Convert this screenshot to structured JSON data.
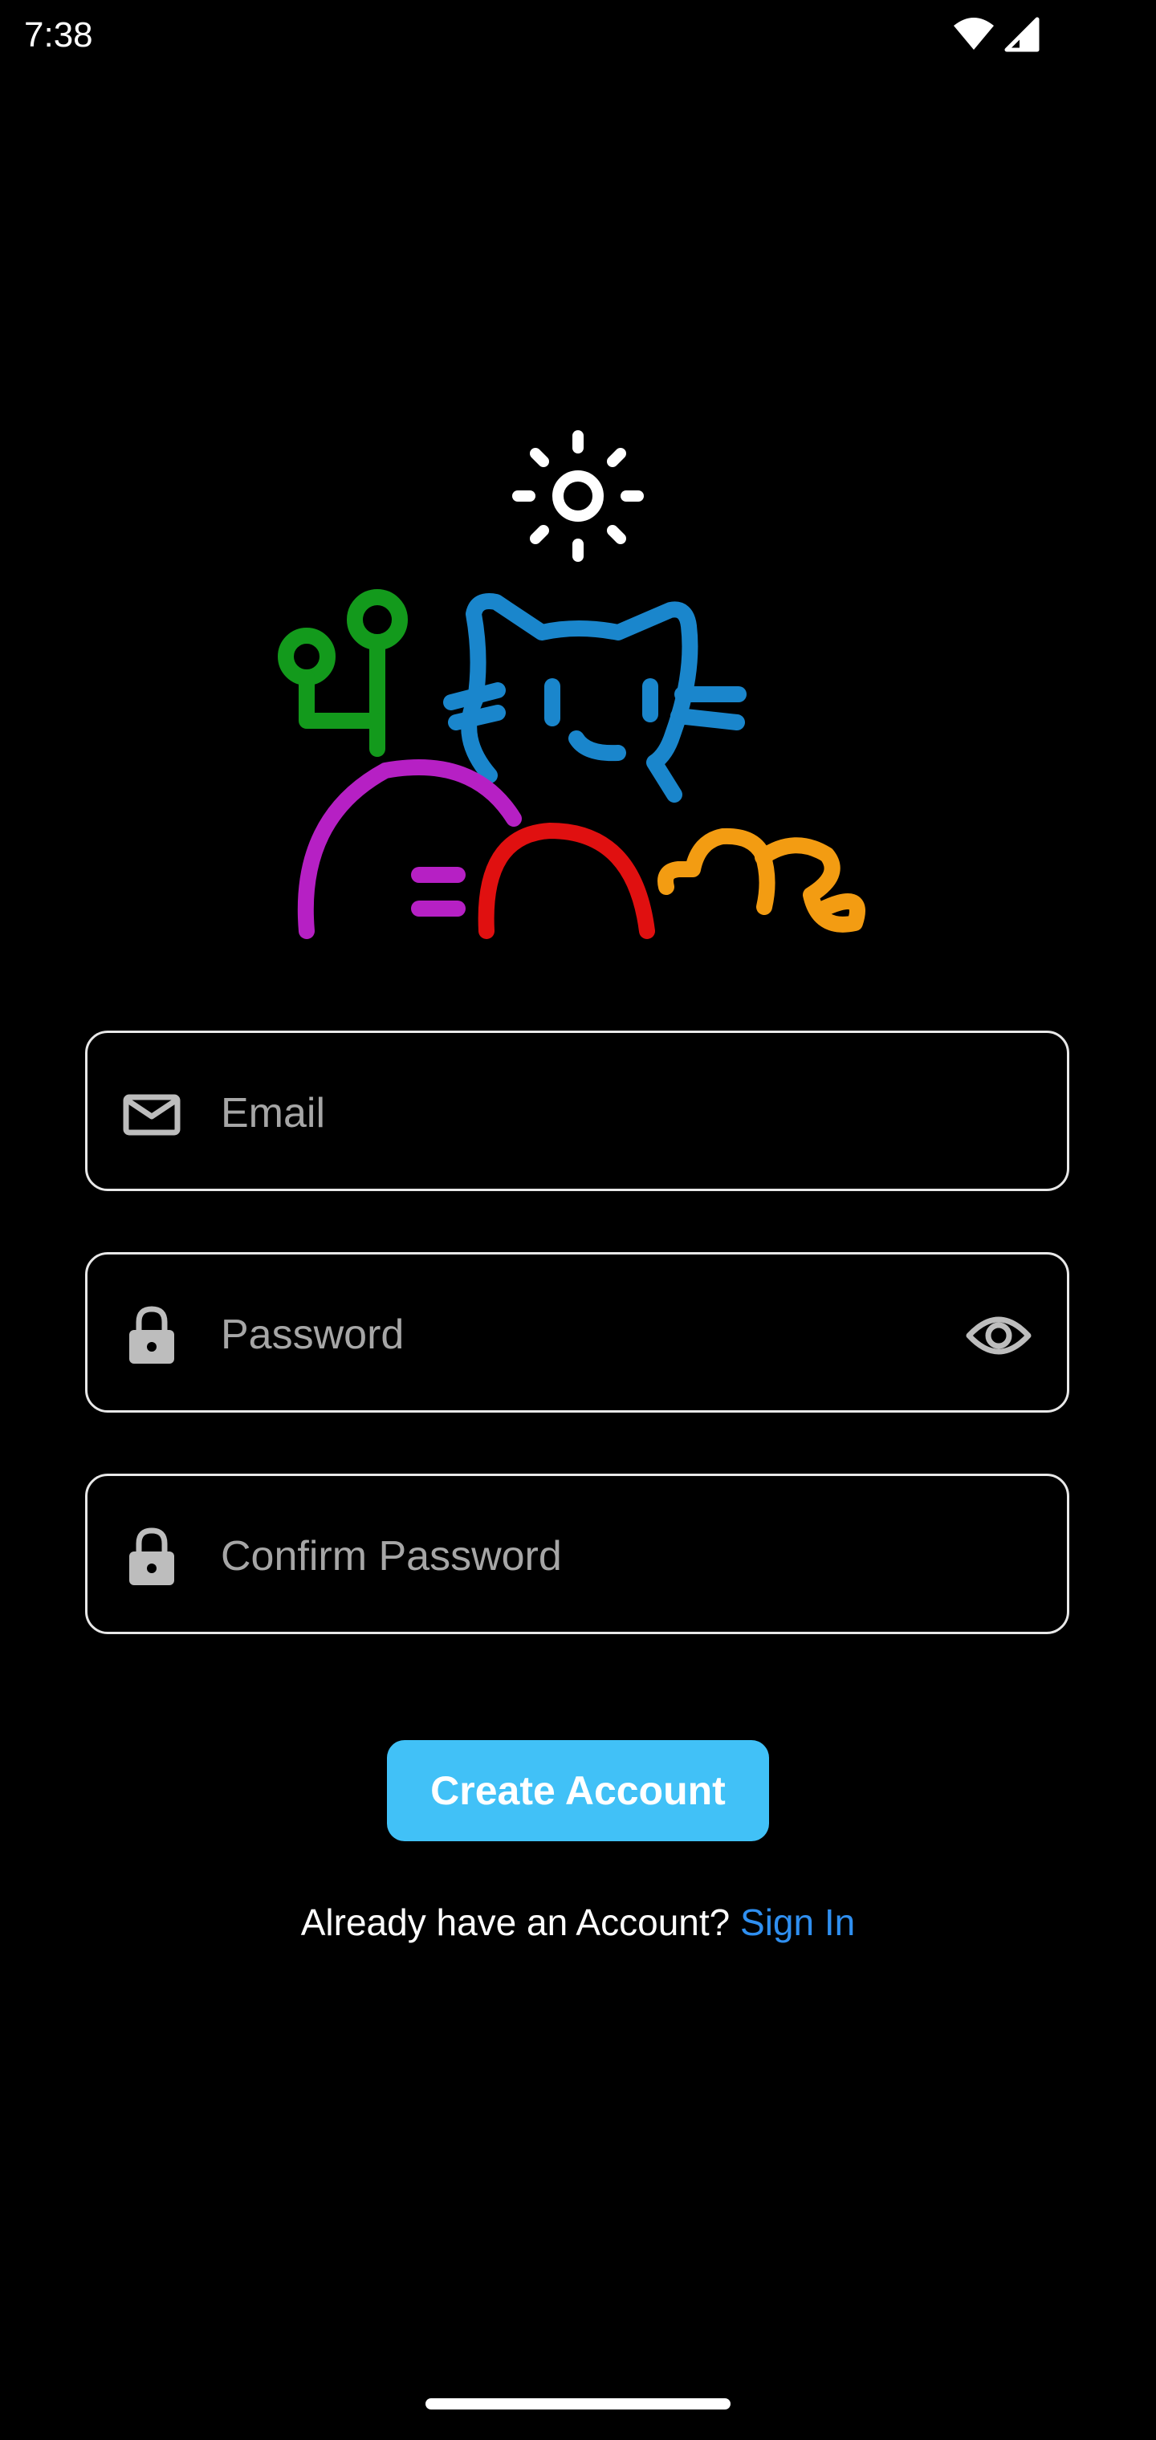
{
  "status_bar": {
    "time": "7:38",
    "icons": [
      "wifi-icon",
      "signal-icon"
    ]
  },
  "logo": {
    "icons": [
      "sun-icon",
      "plant-icon",
      "cat-icon",
      "arch-icon",
      "caterpillar-icon"
    ],
    "colors": {
      "sun": "#ffffff",
      "plant": "#139a1c",
      "cat": "#1a86cc",
      "magenta_arch": "#b620c4",
      "red_arch": "#e01010",
      "caterpillar": "#f39c12"
    }
  },
  "form": {
    "email_placeholder": "Email",
    "email_value": "",
    "password_placeholder": "Password",
    "password_value": "",
    "confirm_placeholder": "Confirm Password",
    "confirm_value": "",
    "create_label": "Create Account",
    "already_text": "Already have an Account?",
    "sign_in_label": "Sign In"
  },
  "colors": {
    "background": "#000000",
    "accent_button": "#41c1f7",
    "link": "#2f8ff0",
    "field_border": "#e8e8e8",
    "placeholder": "#a6a6a6"
  }
}
